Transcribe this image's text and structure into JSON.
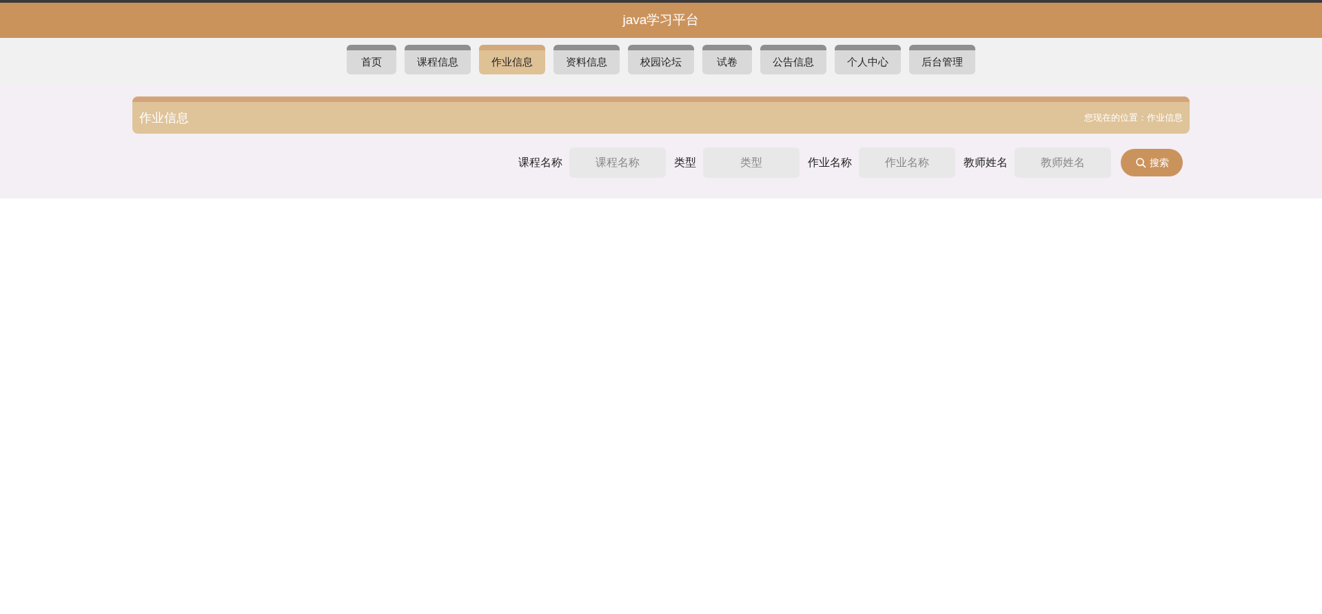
{
  "header": {
    "title": "java学习平台"
  },
  "nav": [
    {
      "label": "首页",
      "selected": false
    },
    {
      "label": "课程信息",
      "selected": false
    },
    {
      "label": "作业信息",
      "selected": true
    },
    {
      "label": "资料信息",
      "selected": false
    },
    {
      "label": "校园论坛",
      "selected": false
    },
    {
      "label": "试卷",
      "selected": false
    },
    {
      "label": "公告信息",
      "selected": false
    },
    {
      "label": "个人中心",
      "selected": false
    },
    {
      "label": "后台管理",
      "selected": false
    }
  ],
  "panel": {
    "title": "作业信息",
    "breadcrumb": "您现在的位置：作业信息"
  },
  "filters": [
    {
      "label": "课程名称",
      "placeholder": "课程名称"
    },
    {
      "label": "类型",
      "placeholder": "类型"
    },
    {
      "label": "作业名称",
      "placeholder": "作业名称"
    },
    {
      "label": "教师姓名",
      "placeholder": "教师姓名"
    }
  ],
  "search_button": "搜索"
}
